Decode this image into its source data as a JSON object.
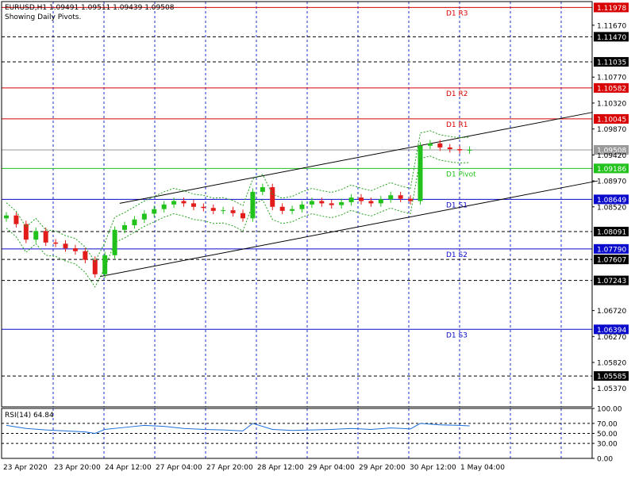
{
  "header": {
    "symbol_line": "EURUSD,H1  1.09491 1.09511 1.09439 1.09508",
    "subtitle": "Showing Daily Pivots."
  },
  "colors": {
    "background": "#ffffff",
    "grid": "#1b2cc9",
    "frame": "#000000",
    "bull_candle": "#21c21b",
    "bear_candle": "#e21b1b",
    "resistance_line": "#d80000",
    "support_line": "#0a0acc",
    "pivot_line": "#21c21b",
    "channel_line": "#000000",
    "envelope": "#21a21b",
    "rsi_line": "#1e6fd9",
    "current_price_tag": "#9a9a9a"
  },
  "icons": {
    "fractal": "gray-triangle-marker"
  },
  "chart_data": [
    {
      "type": "line",
      "title": "",
      "symbol": "EURUSD",
      "timeframe": "H1",
      "ohlc_info": {
        "open": 1.09491,
        "high": 1.09511,
        "low": 1.09439,
        "close": 1.09508
      },
      "ylim": [
        1.0505,
        1.1208
      ],
      "y_tick_labels": [
        "1.11978",
        "1.11670",
        "1.11470",
        "1.11035",
        "1.10770",
        "1.10582",
        "1.10320",
        "1.10045",
        "1.09870",
        "1.09508",
        "1.09420",
        "1.09186",
        "1.08970",
        "1.08649",
        "1.08520",
        "1.08091",
        "1.07790",
        "1.07607",
        "1.07243",
        "1.06720",
        "1.06394",
        "1.06270",
        "1.05820",
        "1.05585",
        "1.05370"
      ],
      "x_tick_labels": [
        "23 Apr 2020",
        "23 Apr 20:00",
        "24 Apr 12:00",
        "27 Apr 04:00",
        "27 Apr 20:00",
        "28 Apr 12:00",
        "29 Apr 04:00",
        "29 Apr 20:00",
        "30 Apr 12:00",
        "1 May 04:00"
      ],
      "x_range_hours": [
        0,
        96
      ],
      "grid": true,
      "pivot_levels": [
        {
          "name": "D1 R3",
          "value": 1.11978,
          "kind": "resistance"
        },
        {
          "name": "D1 R2",
          "value": 1.10582,
          "kind": "resistance"
        },
        {
          "name": "D1 R1",
          "value": 1.10045,
          "kind": "resistance"
        },
        {
          "name": "D1 Pivot",
          "value": 1.09186,
          "kind": "pivot"
        },
        {
          "name": "D1 S1",
          "value": 1.08649,
          "kind": "support"
        },
        {
          "name": "D1 S2",
          "value": 1.0779,
          "kind": "support"
        },
        {
          "name": "D1 S3",
          "value": 1.06394,
          "kind": "support"
        }
      ],
      "horizontal_levels": [
        1.1147,
        1.11035,
        1.08091,
        1.07607,
        1.07243,
        1.05585
      ],
      "current_price": 1.09508,
      "channel": {
        "upper": {
          "x": [
            23,
            119
          ],
          "y": [
            1.0858,
            1.1016
          ]
        },
        "lower": {
          "x": [
            19,
            120
          ],
          "y": [
            1.0731,
            1.0897
          ]
        }
      },
      "series": [
        {
          "name": "EURUSD close",
          "x": [
            0,
            2,
            4,
            6,
            8,
            10,
            12,
            14,
            16,
            18,
            20,
            22,
            24,
            26,
            28,
            30,
            32,
            34,
            36,
            38,
            40,
            42,
            44,
            46,
            48,
            50,
            52,
            54,
            56,
            58,
            60,
            62,
            64,
            66,
            68,
            70,
            72,
            74,
            76,
            78,
            80,
            82,
            84,
            86,
            88,
            90,
            92,
            94
          ],
          "values": [
            1.0837,
            1.0822,
            1.0795,
            1.081,
            1.079,
            1.0788,
            1.078,
            1.0775,
            1.076,
            1.0735,
            1.0768,
            1.0812,
            1.082,
            1.083,
            1.084,
            1.0848,
            1.0856,
            1.0862,
            1.0858,
            1.0852,
            1.085,
            1.0845,
            1.0846,
            1.0841,
            1.0832,
            1.0878,
            1.0886,
            1.0852,
            1.0845,
            1.0848,
            1.0856,
            1.0862,
            1.0858,
            1.0855,
            1.086,
            1.0868,
            1.0862,
            1.0858,
            1.0865,
            1.0872,
            1.0866,
            1.0862,
            1.0958,
            1.0962,
            1.0955,
            1.0952,
            1.095,
            1.09508
          ]
        }
      ]
    },
    {
      "type": "line",
      "title": "RSI(14) 64.84",
      "ylim": [
        0,
        100
      ],
      "y_tick_labels": [
        "100.00",
        "70.00",
        "50.00",
        "30.00",
        "0.00"
      ],
      "levels": [
        70,
        50,
        30
      ],
      "series": [
        {
          "name": "RSI(14)",
          "x": [
            0,
            4,
            8,
            12,
            16,
            18,
            20,
            24,
            28,
            32,
            36,
            40,
            44,
            48,
            50,
            54,
            58,
            62,
            66,
            70,
            74,
            78,
            82,
            84,
            88,
            92,
            94
          ],
          "values": [
            66,
            60,
            57,
            55,
            53,
            50,
            58,
            62,
            66,
            64,
            60,
            58,
            57,
            55,
            70,
            58,
            56,
            57,
            58,
            60,
            58,
            61,
            59,
            70,
            67,
            66,
            65
          ]
        }
      ]
    }
  ]
}
